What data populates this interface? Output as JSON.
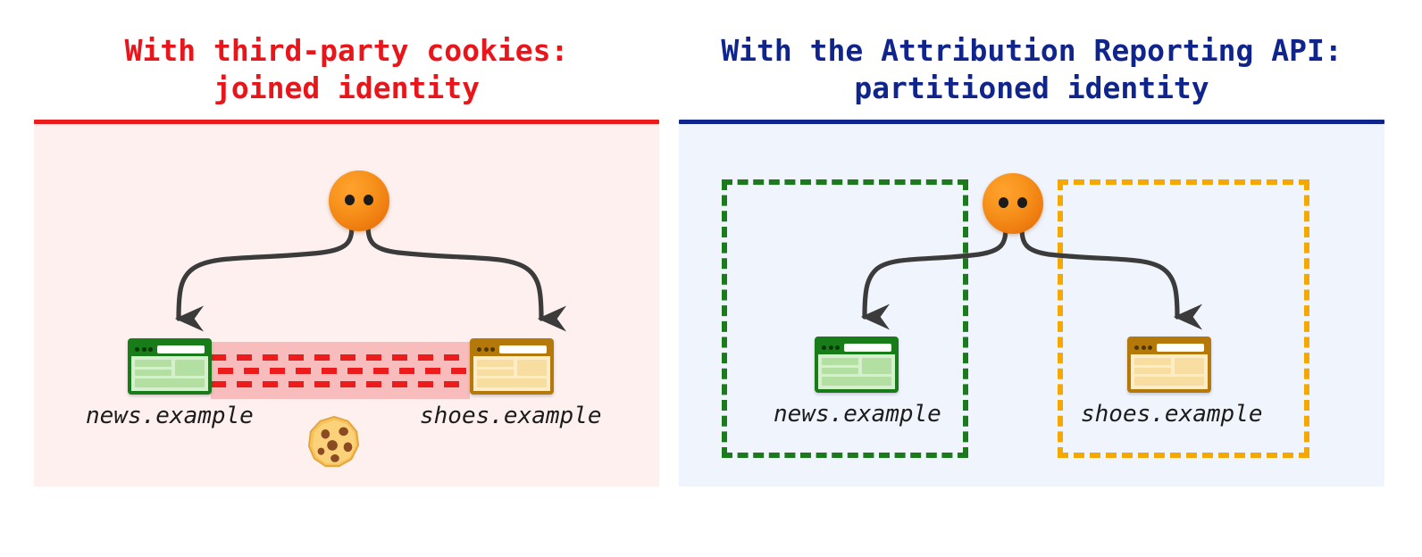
{
  "panels": [
    {
      "id": "third-party-cookies",
      "title": "With third-party cookies:\njoined identity",
      "title_color": "#e8151b",
      "rule_color": "#ec1c1c",
      "background": "#fdf0ef",
      "avatar": {
        "name": "user-identity-avatar",
        "eyes": 2,
        "color": "#f7931c"
      },
      "sites": [
        {
          "key": "news",
          "label": "news.example",
          "window_color": "#187c18",
          "theme": "green"
        },
        {
          "key": "shoes",
          "label": "shoes.example",
          "window_color": "#b5790a",
          "theme": "amber"
        }
      ],
      "join_band": {
        "name": "joined-identity-band",
        "fill": "#f9bcbc",
        "dash_color": "#ec1c1c",
        "dash_rows": 3
      },
      "cookie": {
        "name": "cookie-icon",
        "glyph": "🍪"
      }
    },
    {
      "id": "attribution-reporting-api",
      "title": "With the Attribution Reporting API:\npartitioned identity",
      "title_color": "#10258c",
      "rule_color": "#10258c",
      "background": "#f0f4fd",
      "avatar": {
        "name": "user-identity-avatar",
        "eyes": 2,
        "color": "#f7931c"
      },
      "sites": [
        {
          "key": "news",
          "label": "news.example",
          "window_color": "#187c18",
          "theme": "green",
          "partition_color": "#1b7a1b"
        },
        {
          "key": "shoes",
          "label": "shoes.example",
          "window_color": "#b5790a",
          "theme": "amber",
          "partition_color": "#f5a800"
        }
      ]
    }
  ],
  "arrow_color": "#3b3b3b"
}
